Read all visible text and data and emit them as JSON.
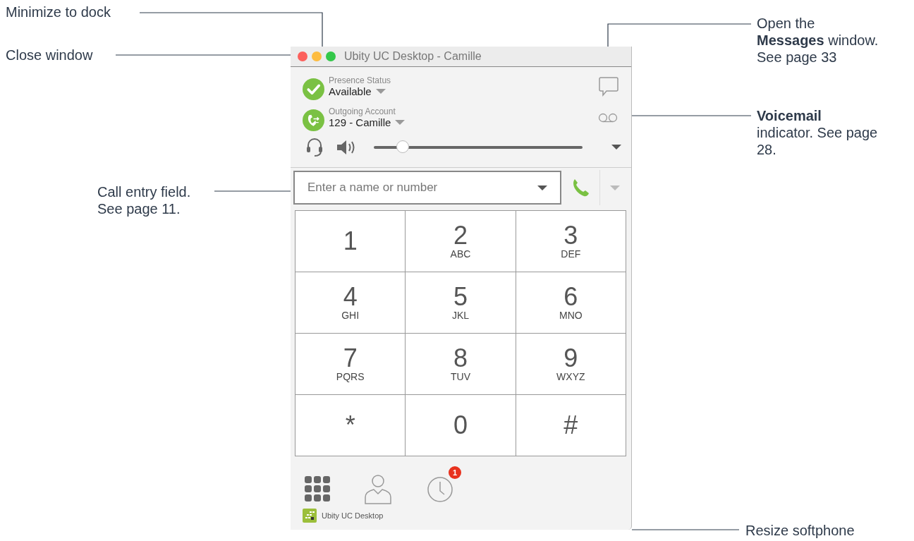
{
  "callouts": [
    {
      "kind": "minimize",
      "lines": [
        "Minimize to dock"
      ]
    },
    {
      "kind": "close",
      "lines": [
        "Close window"
      ]
    },
    {
      "kind": "entry",
      "lines": [
        "Call entry field.",
        "See page 11."
      ]
    },
    {
      "kind": "messages",
      "lines": [
        "Open the",
        "**Messages** window.",
        "See page 33"
      ]
    },
    {
      "kind": "voicemail",
      "lines": [
        "**Voicemail**",
        "indicator. See page",
        "28."
      ]
    },
    {
      "kind": "resize",
      "lines": [
        "Resize softphone"
      ]
    }
  ],
  "window": {
    "title": "Ubity UC Desktop - Camille"
  },
  "presence": {
    "label": "Presence Status",
    "value": "Available"
  },
  "account": {
    "label": "Outgoing Account",
    "value": "129 - Camille"
  },
  "volume": {
    "level": 0.14
  },
  "call_entry": {
    "placeholder": "Enter a name or number"
  },
  "keypad": [
    {
      "digit": "1"
    },
    {
      "digit": "2",
      "letters": "ABC"
    },
    {
      "digit": "3",
      "letters": "DEF"
    },
    {
      "digit": "4",
      "letters": "GHI"
    },
    {
      "digit": "5",
      "letters": "JKL"
    },
    {
      "digit": "6",
      "letters": "MNO"
    },
    {
      "digit": "7",
      "letters": "PQRS"
    },
    {
      "digit": "8",
      "letters": "TUV"
    },
    {
      "digit": "9",
      "letters": "WXYZ"
    },
    {
      "digit": "*"
    },
    {
      "digit": "0"
    },
    {
      "digit": "#"
    }
  ],
  "bottom_tabs": [
    {
      "kind": "dialpad",
      "selected": true
    },
    {
      "kind": "contacts",
      "selected": false
    },
    {
      "kind": "history",
      "selected": false,
      "badge": "1"
    }
  ],
  "footer": {
    "app_name": "Ubity UC Desktop"
  }
}
